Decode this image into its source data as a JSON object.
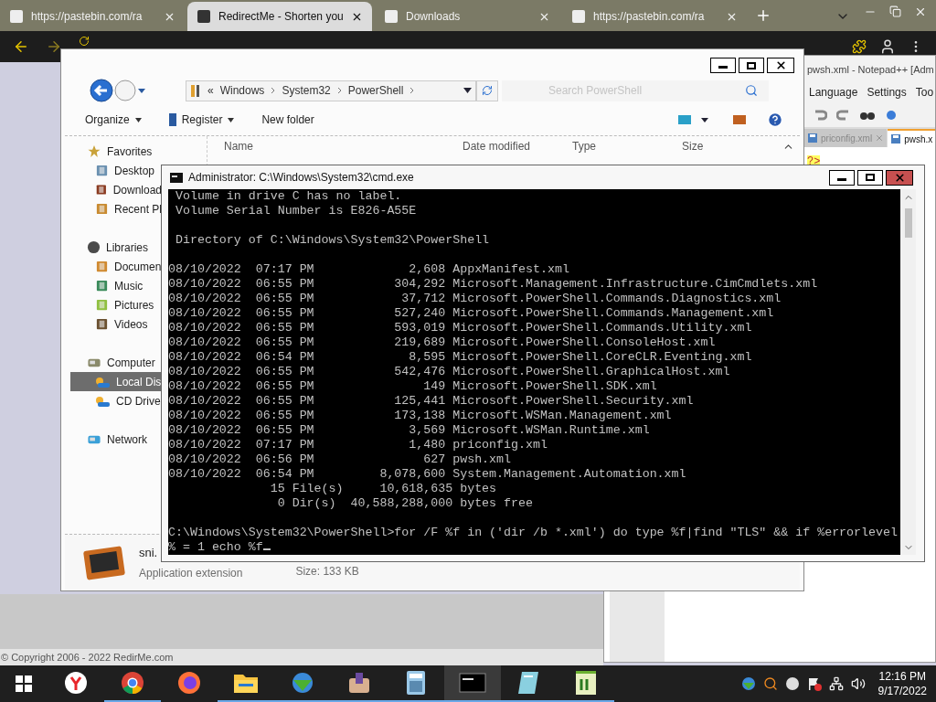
{
  "browser": {
    "tabs": [
      {
        "title": "https://pastebin.com/ra",
        "selected": false
      },
      {
        "title": "RedirectMe - Shorten you",
        "selected": true
      },
      {
        "title": "Downloads",
        "selected": false
      },
      {
        "title": "https://pastebin.com/ra",
        "selected": false
      }
    ],
    "footer": "© Copyright 2006 - 2022 RedirMe.com"
  },
  "notepadpp": {
    "title": "pwsh.xml - Notepad++ [Adm",
    "menu": [
      "Language",
      "Settings",
      "Too"
    ],
    "tabs": [
      {
        "label": "priconfig.xml",
        "selected": false
      },
      {
        "label": "pwsh.x",
        "selected": true
      }
    ],
    "code_fragment": "?>"
  },
  "explorer": {
    "breadcrumb_overflow": "«",
    "breadcrumb": [
      "Windows",
      "System32",
      "PowerShell"
    ],
    "search": {
      "placeholder": "Search PowerShell"
    },
    "toolbar": [
      {
        "label": "Organize",
        "has_menu": true
      },
      {
        "label": "Register",
        "has_menu": true
      },
      {
        "label": "New folder",
        "has_menu": false
      }
    ],
    "nav": [
      {
        "label": "Favorites",
        "selected": false,
        "children": [
          {
            "label": "Desktop",
            "selected": false
          },
          {
            "label": "Download",
            "selected": false
          },
          {
            "label": "Recent Pl",
            "selected": false
          }
        ]
      },
      {
        "label": "Libraries",
        "selected": false,
        "children": [
          {
            "label": "Documen",
            "selected": false
          },
          {
            "label": "Music",
            "selected": false
          },
          {
            "label": "Pictures",
            "selected": false
          },
          {
            "label": "Videos",
            "selected": false
          }
        ]
      },
      {
        "label": "Computer",
        "selected": false,
        "children": [
          {
            "label": "Local Dis",
            "selected": true
          },
          {
            "label": "CD Drive",
            "selected": false
          }
        ]
      },
      {
        "label": "Network",
        "selected": false
      }
    ],
    "columns": [
      "Name",
      "Date modified",
      "Type",
      "Size"
    ],
    "details": {
      "name": "sni.",
      "type": "Application extension",
      "size": "Size: 133 KB"
    }
  },
  "cmd": {
    "title": "Administrator: C:\\Windows\\System32\\cmd.exe",
    "blocks": [
      [
        " Volume in drive C has no label.",
        " Volume Serial Number is E826-A55E"
      ],
      [
        " Directory of C:\\Windows\\System32\\PowerShell"
      ],
      [
        "08/10/2022  07:17 PM             2,608 AppxManifest.xml",
        "08/10/2022  06:55 PM           304,292 Microsoft.Management.Infrastructure.CimCmdlets.xml",
        "08/10/2022  06:55 PM            37,712 Microsoft.PowerShell.Commands.Diagnostics.xml",
        "08/10/2022  06:55 PM           527,240 Microsoft.PowerShell.Commands.Management.xml",
        "08/10/2022  06:55 PM           593,019 Microsoft.PowerShell.Commands.Utility.xml",
        "08/10/2022  06:55 PM           219,689 Microsoft.PowerShell.ConsoleHost.xml",
        "08/10/2022  06:54 PM             8,595 Microsoft.PowerShell.CoreCLR.Eventing.xml",
        "08/10/2022  06:55 PM           542,476 Microsoft.PowerShell.GraphicalHost.xml",
        "08/10/2022  06:55 PM               149 Microsoft.PowerShell.SDK.xml",
        "08/10/2022  06:55 PM           125,441 Microsoft.PowerShell.Security.xml",
        "08/10/2022  06:55 PM           173,138 Microsoft.WSMan.Management.xml",
        "08/10/2022  06:55 PM             3,569 Microsoft.WSMan.Runtime.xml",
        "08/10/2022  07:17 PM             1,480 priconfig.xml",
        "08/10/2022  06:56 PM               627 pwsh.xml",
        "08/10/2022  06:54 PM         8,078,600 System.Management.Automation.xml",
        "              15 File(s)     10,618,635 bytes",
        "               0 Dir(s)  40,588,288,000 bytes free"
      ],
      [
        "C:\\Windows\\System32\\PowerShell>for /F %f in ('dir /b *.xml') do type %f|find \"TLS\" && if %errorlevel",
        "% = 1 echo %f"
      ]
    ]
  },
  "taskbar": {
    "apps": [
      {
        "running": false,
        "active": false
      },
      {
        "running": true,
        "active": false
      },
      {
        "running": false,
        "active": false
      },
      {
        "running": true,
        "active": false
      },
      {
        "running": true,
        "active": false
      },
      {
        "running": true,
        "active": false
      },
      {
        "running": true,
        "active": false
      },
      {
        "running": true,
        "active": true
      },
      {
        "running": true,
        "active": false
      },
      {
        "running": true,
        "active": false
      }
    ],
    "clock": {
      "time": "12:16 PM",
      "date": "9/17/2022"
    }
  }
}
